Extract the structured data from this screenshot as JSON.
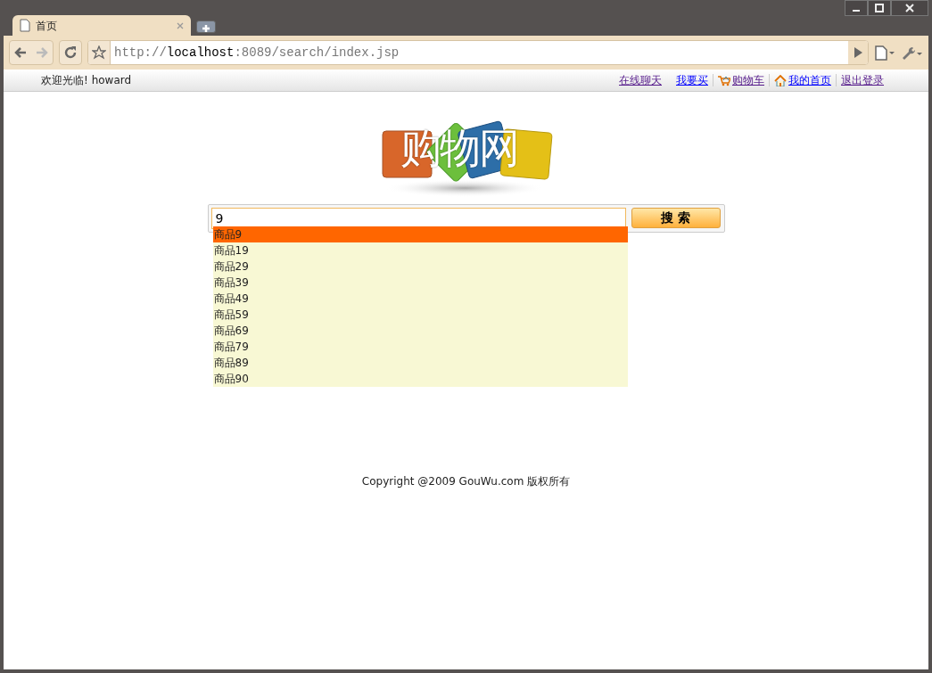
{
  "browser": {
    "tab": {
      "title": "首页",
      "selected": true
    },
    "address": {
      "scheme": "http://",
      "host": "localhost",
      "rest": ":8089/search/index.jsp"
    }
  },
  "top_bar": {
    "welcome": "欢迎光临! howard",
    "links": [
      {
        "label": "在线聊天",
        "visited": true,
        "kind": "plain"
      },
      {
        "label": "我要买",
        "visited": false,
        "kind": "plain"
      },
      {
        "label": "购物车",
        "visited": true,
        "kind": "cart"
      },
      {
        "label": "我的首页",
        "visited": false,
        "kind": "home"
      },
      {
        "label": "退出登录",
        "visited": true,
        "kind": "plain"
      }
    ]
  },
  "logo": {
    "text": "购物网"
  },
  "search": {
    "value": "9",
    "button": "搜 索"
  },
  "suggestions": [
    {
      "label": "商品9",
      "selected": true
    },
    {
      "label": "商品19",
      "selected": false
    },
    {
      "label": "商品29",
      "selected": false
    },
    {
      "label": "商品39",
      "selected": false
    },
    {
      "label": "商品49",
      "selected": false
    },
    {
      "label": "商品59",
      "selected": false
    },
    {
      "label": "商品69",
      "selected": false
    },
    {
      "label": "商品79",
      "selected": false
    },
    {
      "label": "商品89",
      "selected": false
    },
    {
      "label": "商品90",
      "selected": false
    }
  ],
  "footer": "Copyright @2009 GouWu.com 版权所有"
}
